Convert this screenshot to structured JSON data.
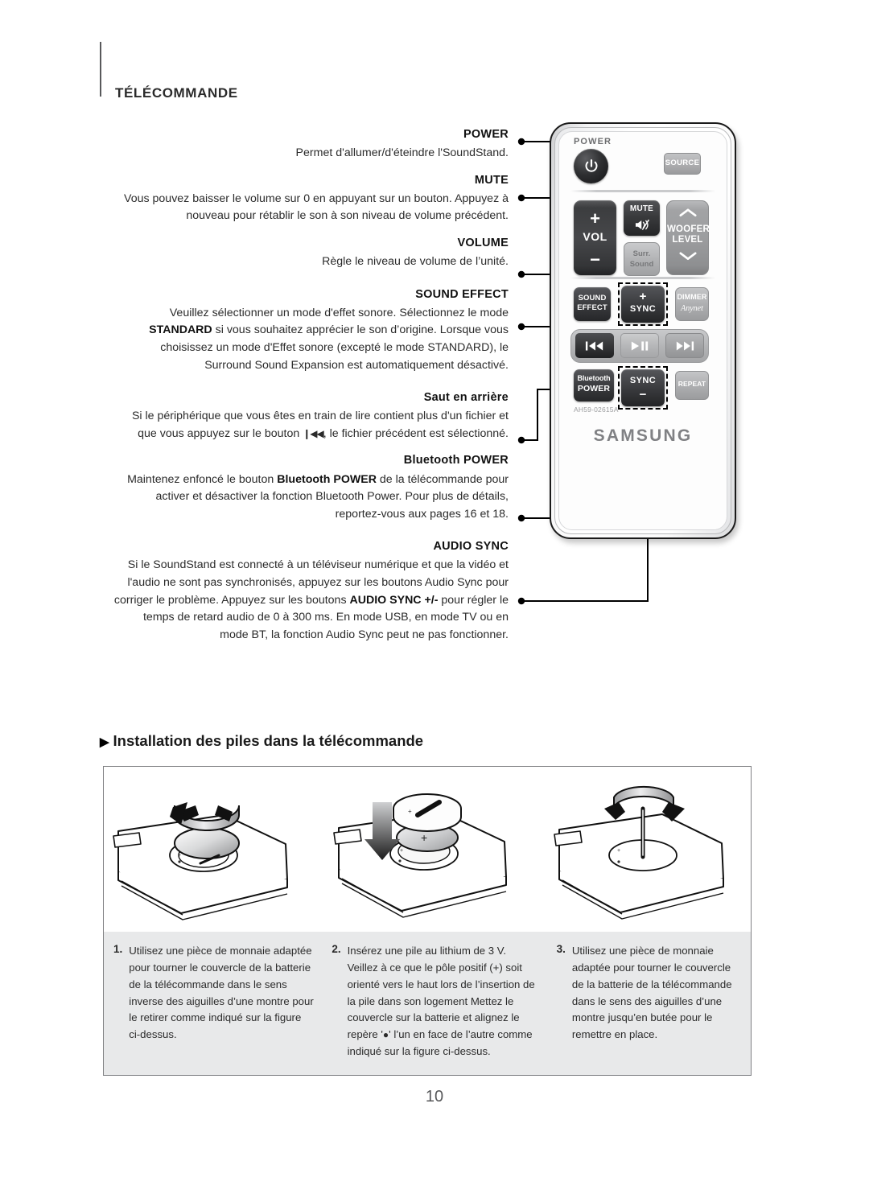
{
  "page": {
    "section_title": "TÉLÉCOMMANDE",
    "page_number": "10"
  },
  "callouts": [
    {
      "label": "POWER",
      "body_html": "Permet d'allumer/d'éteindre l'SoundStand."
    },
    {
      "label": "MUTE",
      "body_html": "Vous pouvez baisser le volume sur 0 en appuyant sur un bouton. Appuyez à nouveau pour rétablir le son à son niveau de volume précédent."
    },
    {
      "label": "VOLUME",
      "body_html": "Règle le niveau de volume de l’unité."
    },
    {
      "label": "SOUND EFFECT",
      "body_html": "Veuillez sélectionner un mode d'effet sonore. Sélectionnez le mode <b>STANDARD</b> si vous souhaitez apprécier le son d’origine. Lorsque vous choisissez un mode d'Effet sonore (excepté le mode STANDARD), le Surround Sound Expansion est automatiquement désactivé."
    },
    {
      "label": "Saut en arrière",
      "body_html": "Si le périphérique que vous êtes en train de lire contient plus d'un fichier et que vous appuyez sur le bouton <span class=\"skipglyph\">❙◀◀</span>, le fichier précédent est sélectionné."
    },
    {
      "label": "Bluetooth POWER",
      "body_html": "Maintenez enfoncé le bouton <b>Bluetooth POWER</b> de la télécommande pour activer et désactiver la fonction Bluetooth Power. Pour plus de détails, reportez-vous aux pages 16 et 18."
    },
    {
      "label": "AUDIO SYNC",
      "body_html": "Si le SoundStand est connecté à un téléviseur numérique et que la vidéo et l'audio ne sont pas synchronisés, appuyez sur les boutons Audio Sync pour corriger le problème. Appuyez sur les boutons <b>AUDIO SYNC +/-</b> pour régler le temps de retard audio de 0 à 300 ms. En mode USB, en mode TV ou en mode BT, la fonction Audio Sync peut ne pas fonctionner."
    }
  ],
  "remote": {
    "power_caption": "POWER",
    "source": "SOURCE",
    "vol_plus": "+",
    "vol_text": "VOL",
    "vol_minus": "−",
    "mute": "MUTE",
    "surr_line1": "Surr.",
    "surr_line2": "Sound",
    "woofer_line1": "WOOFER",
    "woofer_line2": "LEVEL",
    "sound_effect_line1": "SOUND",
    "sound_effect_line2": "EFFECT",
    "sync_plus_sign": "+",
    "sync_plus_text": "SYNC",
    "dimmer": "DIMMER",
    "dimmer_script": "Anynet",
    "bt_line1": "Bluetooth",
    "bt_line2": "POWER",
    "sync_minus_text": "SYNC",
    "sync_minus_sign": "−",
    "repeat": "REPEAT",
    "model_number": "AH59-02615A",
    "brand": "SAMSUNG"
  },
  "battery_section": {
    "heading": "Installation des piles dans la télécommande",
    "heading_arrow": "▶",
    "steps": [
      {
        "number": "1.",
        "text_html": "Utilisez une pièce de monnaie adaptée pour tourner le couvercle de la batterie de la télécommande dans le sens inverse des aiguilles d’une montre pour le retirer comme indiqué sur la figure ci-dessus."
      },
      {
        "number": "2.",
        "text_html": "Insérez une pile au lithium de 3 V. Veillez à ce que le pôle positif (+) soit orienté vers le haut lors de l’insertion de la pile dans son logement Mettez le couvercle sur la batterie et alignez le repère '<span class=\"dotmark\">●</span>' l’un en face de l’autre comme indiqué sur la figure ci-dessus."
      },
      {
        "number": "3.",
        "text_html": "Utilisez une pièce de monnaie adaptée pour tourner le couvercle de la batterie de la télécommande dans le sens des aiguilles d’une montre jusqu’en butée pour le remettre en place."
      }
    ]
  },
  "colors": {
    "text": "#2b2b2b",
    "heading": "#1a1a1a",
    "panel_band": "#e8e9ea",
    "brand_gray": "#808184"
  }
}
